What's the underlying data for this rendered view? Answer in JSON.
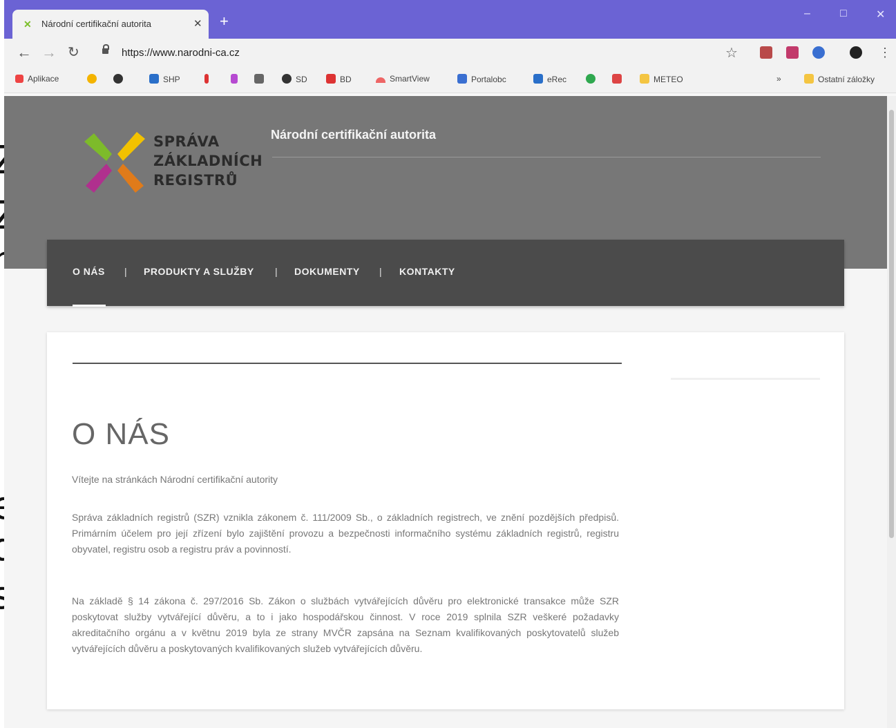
{
  "browser": {
    "tab_title": "Národní certifikační autorita",
    "url": "https://www.narodni-ca.cz",
    "window_controls": [
      "–",
      "□",
      "✕"
    ],
    "new_tab_label": "+"
  },
  "bookmarks": {
    "items": [
      "Aplikace",
      "SHP",
      "SD",
      "BD",
      "SmartView",
      "Portalobc",
      "eRec",
      "METEO"
    ],
    "overflow": "»",
    "other": "Ostatní záložky"
  },
  "site": {
    "logo_lines": [
      "SPRÁVA",
      "ZÁKLADNÍCH",
      "REGISTRŮ"
    ],
    "title": "Národní certifikační autorita",
    "nav": [
      "O NÁS",
      "PRODUKTY A SLUŽBY",
      "DOKUMENTY",
      "KONTAKTY"
    ],
    "nav_separator": "|",
    "active_nav": "O NÁS"
  },
  "content": {
    "heading": "O NÁS",
    "welcome": "Vítejte na stránkách Národní certifikační autority",
    "paragraphs": [
      "Správa základních registrů (SZR) vznikla zákonem č. 111/2009 Sb., o základních registrech, ve znění pozdějších předpisů. Primárním účelem pro její zřízení bylo zajištění provozu a bezpečnosti informačního systému základních registrů, registru obyvatel, registru osob a registru práv a povinností.",
      "Na základě § 14 zákona č. 297/2016 Sb. Zákon o službách vytvářejících důvěru pro elektronické transakce může SZR poskytovat služby vytvářející důvěru, a to i jako hospodářskou činnost. V roce 2019 splnila SZR veškeré požadavky akreditačního orgánu a v květnu 2019 byla ze strany MVČR zapsána na Seznam kvalifikovaných poskytovatelů služeb vytvářejících důvěru a poskytovaných kvalifikovaných služeb vytvářejících důvěru."
    ]
  },
  "colors": {
    "titlebar": "#6b63d4",
    "hero": "#777777",
    "navbar": "#4b4b4b",
    "logo_green": "#7dbb2a",
    "logo_yellow": "#f2c200",
    "logo_magenta": "#b0308e",
    "logo_orange": "#e07b1a"
  }
}
